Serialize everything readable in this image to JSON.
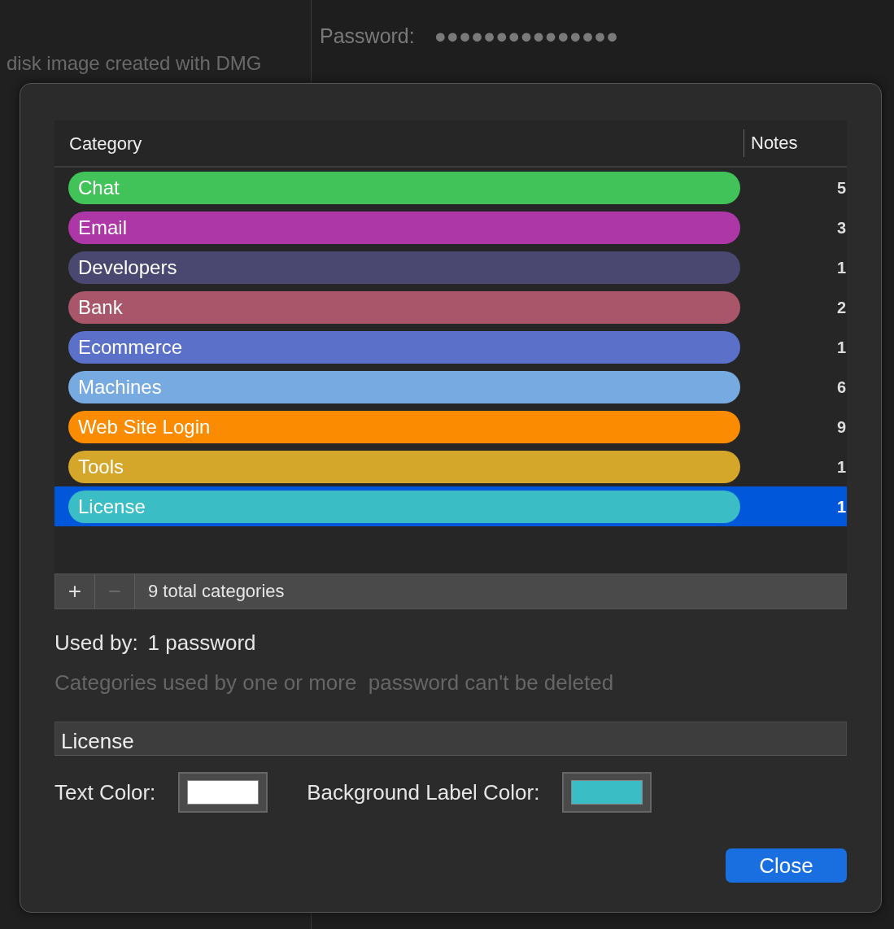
{
  "background": {
    "password_label": "Password:",
    "password_value": "●●●●●●●●●●●●●●●",
    "note": "disk image created with DMG"
  },
  "sheet": {
    "table": {
      "columns": [
        "Category",
        "Notes"
      ],
      "rows": [
        {
          "name": "Chat",
          "color": "#41c35a",
          "notes": "5",
          "selected": false
        },
        {
          "name": "Email",
          "color": "#ae37a8",
          "notes": "3",
          "selected": false
        },
        {
          "name": "Developers",
          "color": "#4a4770",
          "notes": "1",
          "selected": false
        },
        {
          "name": "Bank",
          "color": "#a9566a",
          "notes": "2",
          "selected": false
        },
        {
          "name": "Ecommerce",
          "color": "#5b70c9",
          "notes": "1",
          "selected": false
        },
        {
          "name": "Machines",
          "color": "#78aae2",
          "notes": "6",
          "selected": false
        },
        {
          "name": "Web Site Login",
          "color": "#fb8b00",
          "notes": "9",
          "selected": false
        },
        {
          "name": "Tools",
          "color": "#d4a72a",
          "notes": "1",
          "selected": false
        },
        {
          "name": "License",
          "color": "#3bbdc6",
          "notes": "1",
          "selected": true
        }
      ]
    },
    "add_button": {
      "label": "+",
      "disabled": false
    },
    "remove_button": {
      "label": "−",
      "disabled": true
    },
    "total": "9 total categories",
    "used_by_label": "Used by:",
    "used_by_value": "1 password",
    "hint": "Categories used by one or more  password can't be deleted",
    "name_field": "License",
    "color_wells": [
      {
        "label": "Text Color:",
        "color": "#ffffff"
      },
      {
        "label": "Background Label Color:",
        "color": "#3bbdc6"
      }
    ],
    "close_button": "Close"
  }
}
